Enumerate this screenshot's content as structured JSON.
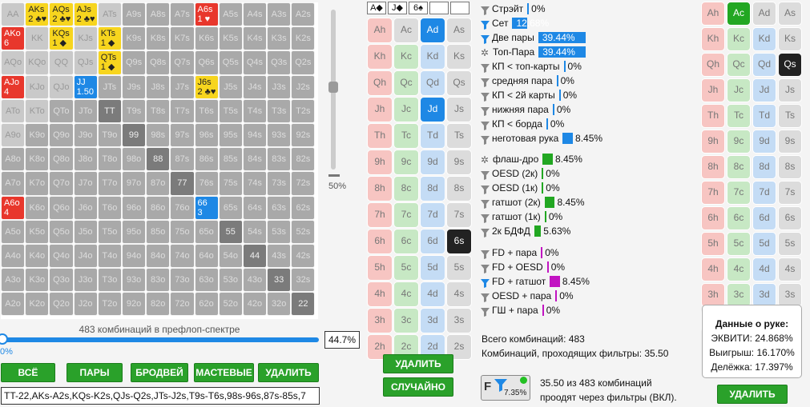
{
  "grid": [
    [
      "AA",
      "AKs",
      "AQs",
      "AJs",
      "ATs",
      "A9s",
      "A8s",
      "A7s",
      "A6s",
      "A5s",
      "A4s",
      "A3s",
      "A2s"
    ],
    [
      "AKo",
      "KK",
      "KQs",
      "KJs",
      "KTs",
      "K9s",
      "K8s",
      "K7s",
      "K6s",
      "K5s",
      "K4s",
      "K3s",
      "K2s"
    ],
    [
      "AQo",
      "KQo",
      "QQ",
      "QJs",
      "QTs",
      "Q9s",
      "Q8s",
      "Q7s",
      "Q6s",
      "Q5s",
      "Q4s",
      "Q3s",
      "Q2s"
    ],
    [
      "AJo",
      "KJo",
      "QJo",
      "JJ",
      "JTs",
      "J9s",
      "J8s",
      "J7s",
      "J6s",
      "J5s",
      "J4s",
      "J3s",
      "J2s"
    ],
    [
      "ATo",
      "KTo",
      "QTo",
      "JTo",
      "TT",
      "T9s",
      "T8s",
      "T7s",
      "T6s",
      "T5s",
      "T4s",
      "T3s",
      "T2s"
    ],
    [
      "A9o",
      "K9o",
      "Q9o",
      "J9o",
      "T9o",
      "99",
      "98s",
      "97s",
      "96s",
      "95s",
      "94s",
      "93s",
      "92s"
    ],
    [
      "A8o",
      "K8o",
      "Q8o",
      "J8o",
      "T8o",
      "98o",
      "88",
      "87s",
      "86s",
      "85s",
      "84s",
      "83s",
      "82s"
    ],
    [
      "A7o",
      "K7o",
      "Q7o",
      "J7o",
      "T7o",
      "97o",
      "87o",
      "77",
      "76s",
      "75s",
      "74s",
      "73s",
      "72s"
    ],
    [
      "A6o",
      "K6o",
      "Q6o",
      "J6o",
      "T6o",
      "96o",
      "86o",
      "76o",
      "66",
      "65s",
      "64s",
      "63s",
      "62s"
    ],
    [
      "A5o",
      "K5o",
      "Q5o",
      "J5o",
      "T5o",
      "95o",
      "85o",
      "75o",
      "65o",
      "55",
      "54s",
      "53s",
      "52s"
    ],
    [
      "A4o",
      "K4o",
      "Q4o",
      "J4o",
      "T4o",
      "94o",
      "84o",
      "74o",
      "64o",
      "54o",
      "44",
      "43s",
      "42s"
    ],
    [
      "A3o",
      "K3o",
      "Q3o",
      "J3o",
      "T3o",
      "93o",
      "83o",
      "73o",
      "63o",
      "53o",
      "43o",
      "33",
      "32s"
    ],
    [
      "A2o",
      "K2o",
      "Q2o",
      "J2o",
      "T2o",
      "92o",
      "82o",
      "72o",
      "62o",
      "52o",
      "42o",
      "32o",
      "22"
    ]
  ],
  "grid_styles": {
    "AA": "g",
    "KK": "g",
    "QQ": "g",
    "TT": "d",
    "99": "d",
    "88": "d",
    "77": "d",
    "55": "d",
    "44": "d",
    "33": "d",
    "22": "d",
    "AKs": "yel",
    "AQs": "yel",
    "AJs": "yel",
    "A6s": "red",
    "KQs": "yel",
    "KTs": "yel",
    "QTs": "yel",
    "JJ": "blue",
    "J6s": "yel",
    "66": "blue",
    "AKo": "red",
    "AJo": "red",
    "A6o": "red"
  },
  "grid_texts": {
    "AKs": "AKs\n2 ♣♥",
    "AQs": "AQs\n2 ♣♥",
    "AJs": "AJs\n2 ♣♥",
    "A6s": "A6s\n1 ♥",
    "AKo": "AKo\n6",
    "AJo": "AJo\n4",
    "A6o": "A6o\n4",
    "KQs": "KQs\n1 ◆",
    "KTs": "KTs\n1 ◆",
    "QTs": "QTs\n1 ◆",
    "JJ": "JJ\n1.50",
    "J6s": "J6s\n2 ♣♥",
    "66": "66\n3"
  },
  "range_label": "483 комбинаций в префлоп-спектре",
  "range_pct": "44.7%",
  "slider_pct": "0%",
  "slider_v_pct": "50%",
  "buttons": {
    "all": "ВСЁ",
    "pairs": "ПАРЫ",
    "broadway": "БРОДВЕЙ",
    "suited": "МАСТЕВЫЕ",
    "delete": "УДАЛИТЬ"
  },
  "range_text": "TT-22,AKs-A2s,KQs-K2s,QJs-Q2s,JTs-J2s,T9s-T6s,98s-96s,87s-85s,7",
  "board": [
    "A◆",
    "J◆",
    "6♠",
    "",
    ""
  ],
  "board_cols": [
    [
      "Ah",
      "Ac",
      "Ad",
      "As"
    ],
    [
      "Kh",
      "Kc",
      "Kd",
      "Ks"
    ],
    [
      "Qh",
      "Qc",
      "Qd",
      "Qs"
    ],
    [
      "Jh",
      "Jc",
      "Jd",
      "Js"
    ],
    [
      "Th",
      "Tc",
      "Td",
      "Ts"
    ],
    [
      "9h",
      "9c",
      "9d",
      "9s"
    ],
    [
      "8h",
      "8c",
      "8d",
      "8s"
    ],
    [
      "7h",
      "7c",
      "7d",
      "7s"
    ],
    [
      "6h",
      "6c",
      "6d",
      "6s"
    ],
    [
      "5h",
      "5c",
      "5d",
      "5s"
    ],
    [
      "4h",
      "4c",
      "4d",
      "4s"
    ],
    [
      "3h",
      "3c",
      "3d",
      "3s"
    ],
    [
      "2h",
      "2c",
      "2d",
      "2s"
    ]
  ],
  "board_buttons": {
    "delete": "УДАЛИТЬ",
    "random": "СЛУЧАЙНО"
  },
  "stats1": [
    {
      "label": "Стрэйт",
      "val": "0%",
      "icon": "gray",
      "bar": 0
    },
    {
      "label": "Сет",
      "val": "12.68%",
      "icon": "blue",
      "bar": 12.68
    },
    {
      "label": "Две пары",
      "val": "39.44%",
      "icon": "blue",
      "bar": 39.44
    },
    {
      "label": "Топ-Пара",
      "val": "39.44%",
      "icon": "gear",
      "bar": 39.44
    },
    {
      "label": "КП < топ-карты",
      "val": "0%",
      "icon": "gray",
      "bar": 0
    },
    {
      "label": "средняя пара",
      "val": "0%",
      "icon": "gray",
      "bar": 0
    },
    {
      "label": "КП < 2й карты",
      "val": "0%",
      "icon": "gray",
      "bar": 0
    },
    {
      "label": "нижняя пара",
      "val": "0%",
      "icon": "gray",
      "bar": 0
    },
    {
      "label": "КП < борда",
      "val": "0%",
      "icon": "gray",
      "bar": 0
    },
    {
      "label": "неготовая рука",
      "val": "8.45%",
      "icon": "gray",
      "bar": 8.45
    }
  ],
  "stats2": [
    {
      "label": "флаш-дро",
      "val": "8.45%",
      "icon": "gear",
      "bar": 8.45
    },
    {
      "label": "OESD (2к)",
      "val": "0%",
      "icon": "gray",
      "bar": 0
    },
    {
      "label": "OESD (1к)",
      "val": "0%",
      "icon": "gray",
      "bar": 0
    },
    {
      "label": "гатшот (2к)",
      "val": "8.45%",
      "icon": "gray",
      "bar": 8.45
    },
    {
      "label": "гатшот (1к)",
      "val": "0%",
      "icon": "gray",
      "bar": 0
    },
    {
      "label": "2к БДФД",
      "val": "5.63%",
      "icon": "gray",
      "bar": 5.63
    }
  ],
  "stats3": [
    {
      "label": "FD + пара",
      "val": "0%",
      "icon": "gray",
      "bar": 0
    },
    {
      "label": "FD + OESD",
      "val": "0%",
      "icon": "gray",
      "bar": 0
    },
    {
      "label": "FD + гатшот",
      "val": "8.45%",
      "icon": "blue",
      "bar": 8.45
    },
    {
      "label": "OESD + пара",
      "val": "0%",
      "icon": "gray",
      "bar": 0
    },
    {
      "label": "ГШ + пара",
      "val": "0%",
      "icon": "gray",
      "bar": 0
    }
  ],
  "totals": {
    "total": "Всего комбинаций: 483",
    "passing": "Комбинаций, проходящих фильтры: 35.50"
  },
  "filter_badge": {
    "letter": "F",
    "pct": "7.35%"
  },
  "filter_text": "35.50 из 483 комбинаций\nпроодят через фильтры (ВКЛ).",
  "hand_cols": [
    [
      "Ah",
      "Ac",
      "Ad",
      "As"
    ],
    [
      "Kh",
      "Kc",
      "Kd",
      "Ks"
    ],
    [
      "Qh",
      "Qc",
      "Qd",
      "Qs"
    ],
    [
      "Jh",
      "Jc",
      "Jd",
      "Js"
    ],
    [
      "Th",
      "Tc",
      "Td",
      "Ts"
    ],
    [
      "9h",
      "9c",
      "9d",
      "9s"
    ],
    [
      "8h",
      "8c",
      "8d",
      "8s"
    ],
    [
      "7h",
      "7c",
      "7d",
      "7s"
    ],
    [
      "6h",
      "6c",
      "6d",
      "6s"
    ],
    [
      "5h",
      "5c",
      "5d",
      "5s"
    ],
    [
      "4h",
      "4c",
      "4d",
      "4s"
    ],
    [
      "3h",
      "3c",
      "3d",
      "3s"
    ],
    [
      "2h",
      "2c",
      "2d",
      "2s"
    ]
  ],
  "hand_info": {
    "title": "Данные о руке:",
    "equity": "ЭКВИТИ: 24.868%",
    "win": "Выигрыш: 16.170%",
    "tie": "Делёжка: 17.397%"
  },
  "hand_delete": "УДАЛИТЬ"
}
